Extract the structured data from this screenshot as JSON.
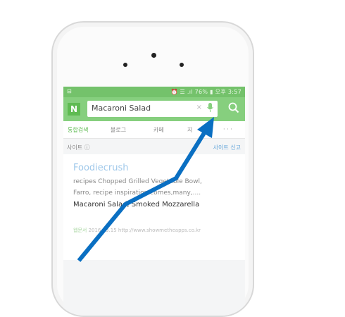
{
  "status_bar": {
    "left_icon": "network-icon",
    "right": "⏰ ☰ .ıl 76% ▮ 오후 3:57"
  },
  "search": {
    "logo": "N",
    "query": "Macaroni Salad",
    "clear_symbol": "×",
    "mic": "mic-icon",
    "button": "search-icon"
  },
  "tabs": [
    "통합검색",
    "블로그",
    "카페",
    "지",
    "· · ·"
  ],
  "section": {
    "title": "사이트 ⓘ",
    "report": "사이트 신고"
  },
  "result": {
    "title": "Foodiecrush",
    "lines": [
      "recipes Chopped Grilled Vegetable Bowl,",
      "Farro, recipe inspiration comes,many,...."
    ],
    "bold_line": "Macaroni Salad, Smoked Mozzarella",
    "source": "웹문서",
    "date": "2016.03.15",
    "url": "http://www.showmetheapps.co.kr"
  },
  "colors": {
    "accent_green": "#86cf7e",
    "arrow_blue": "#0a6fc2"
  }
}
